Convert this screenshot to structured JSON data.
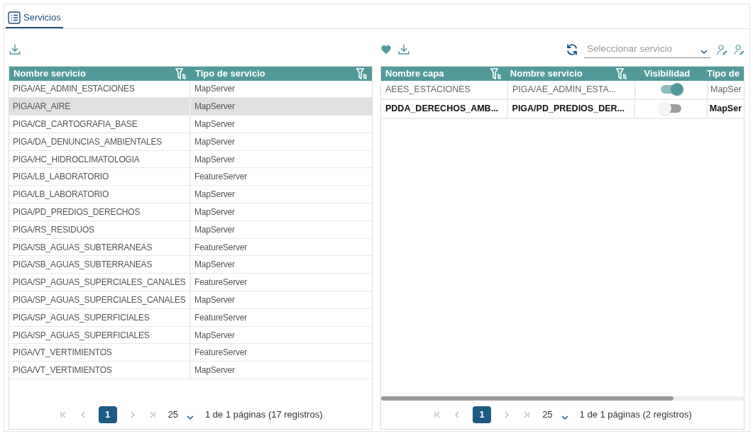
{
  "tabs": [
    {
      "label": "Servicios",
      "selected": true
    }
  ],
  "left": {
    "columns": [
      "Nombre servicio",
      "Tipo de servicio"
    ],
    "rows": [
      {
        "cells": [
          "PIGA/AE_ADMIN_ESTACIONES",
          "MapServer"
        ],
        "selected": false
      },
      {
        "cells": [
          "PIGA/AR_AIRE",
          "MapServer"
        ],
        "selected": true
      },
      {
        "cells": [
          "PIGA/CB_CARTOGRAFIA_BASE",
          "MapServer"
        ],
        "selected": false
      },
      {
        "cells": [
          "PIGA/DA_DENUNCIAS_AMBIENTALES",
          "MapServer"
        ],
        "selected": false
      },
      {
        "cells": [
          "PIGA/HC_HIDROCLIMATOLOGIA",
          "MapServer"
        ],
        "selected": false
      },
      {
        "cells": [
          "PIGA/LB_LABORATORIO",
          "FeatureServer"
        ],
        "selected": false
      },
      {
        "cells": [
          "PIGA/LB_LABORATORIO",
          "MapServer"
        ],
        "selected": false
      },
      {
        "cells": [
          "PIGA/PD_PREDIOS_DERECHOS",
          "MapServer"
        ],
        "selected": false
      },
      {
        "cells": [
          "PIGA/RS_RESIDUOS",
          "MapServer"
        ],
        "selected": false
      },
      {
        "cells": [
          "PIGA/SB_AGUAS_SUBTERRANEAS",
          "FeatureServer"
        ],
        "selected": false
      },
      {
        "cells": [
          "PIGA/SB_AGUAS_SUBTERRANEAS",
          "MapServer"
        ],
        "selected": false
      },
      {
        "cells": [
          "PIGA/SP_AGUAS_SUPERCIALES_CANALES",
          "FeatureServer"
        ],
        "selected": false
      },
      {
        "cells": [
          "PIGA/SP_AGUAS_SUPERCIALES_CANALES",
          "MapServer"
        ],
        "selected": false
      },
      {
        "cells": [
          "PIGA/SP_AGUAS_SUPERFICIALES",
          "FeatureServer"
        ],
        "selected": false
      },
      {
        "cells": [
          "PIGA/SP_AGUAS_SUPERFICIALES",
          "MapServer"
        ],
        "selected": false
      },
      {
        "cells": [
          "PIGA/VT_VERTIMIENTOS",
          "FeatureServer"
        ],
        "selected": false
      },
      {
        "cells": [
          "PIGA/VT_VERTIMIENTOS",
          "MapServer"
        ],
        "selected": false
      }
    ],
    "pagination": {
      "page": "1",
      "page_size": "25",
      "summary": "1 de 1 páginas (17 registros)"
    }
  },
  "right": {
    "select": {
      "placeholder": "Seleccionar servicio"
    },
    "columns": [
      "Nombre capa",
      "Nombre servicio",
      "Visibilidad",
      "Tipo de"
    ],
    "rows": [
      {
        "layer": "AEES_ESTACIONES",
        "service": "PIGA/AE_ADMIN_ESTA...",
        "visible": true,
        "type": "MapSer",
        "selected": false
      },
      {
        "layer": "PDDA_DERECHOS_AMB...",
        "service": "PIGA/PD_PREDIOS_DER...",
        "visible": false,
        "type": "MapSer",
        "selected": true
      }
    ],
    "pagination": {
      "page": "1",
      "page_size": "25",
      "summary": "1 de 1 páginas (2 registros)"
    }
  }
}
